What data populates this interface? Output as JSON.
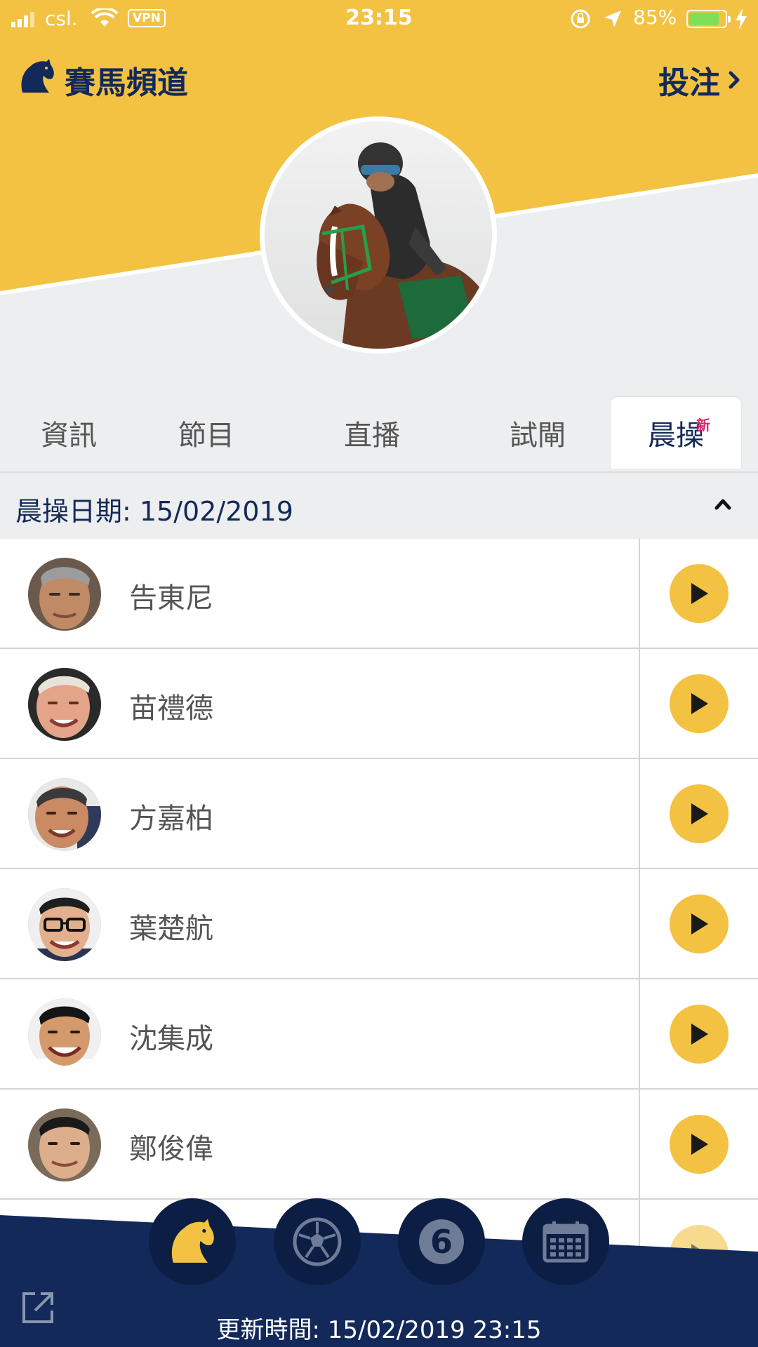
{
  "status_bar": {
    "carrier": "csl.",
    "vpn": "VPN",
    "time": "23:15",
    "battery": "85%",
    "battery_level": 0.85
  },
  "header": {
    "app_title": "賽馬頻道",
    "bet_label": "投注"
  },
  "tabs": [
    {
      "label": "資訊",
      "active": false
    },
    {
      "label": "節目",
      "active": false
    },
    {
      "label": "直播",
      "active": false
    },
    {
      "label": "試閘",
      "active": false
    },
    {
      "label": "晨操",
      "active": true,
      "badge": "新"
    }
  ],
  "date_section": {
    "label": "晨操日期: 15/02/2019"
  },
  "trainers": [
    {
      "name": "告東尼"
    },
    {
      "name": "苗禮德"
    },
    {
      "name": "方嘉柏"
    },
    {
      "name": "葉楚航"
    },
    {
      "name": "沈集成"
    },
    {
      "name": "鄭俊偉"
    }
  ],
  "footer": {
    "update_label": "更新時間: 15/02/2019 23:15",
    "nav_icons": [
      "horse-racing-icon",
      "football-icon",
      "mark-six-icon",
      "calendar-icon"
    ],
    "mark_six_digit": "6"
  },
  "colors": {
    "brand_yellow": "#f3c242",
    "navy": "#12295a",
    "footer_navy": "#12295a",
    "badge_pink": "#e0246a",
    "battery_green": "#7ee05a"
  }
}
